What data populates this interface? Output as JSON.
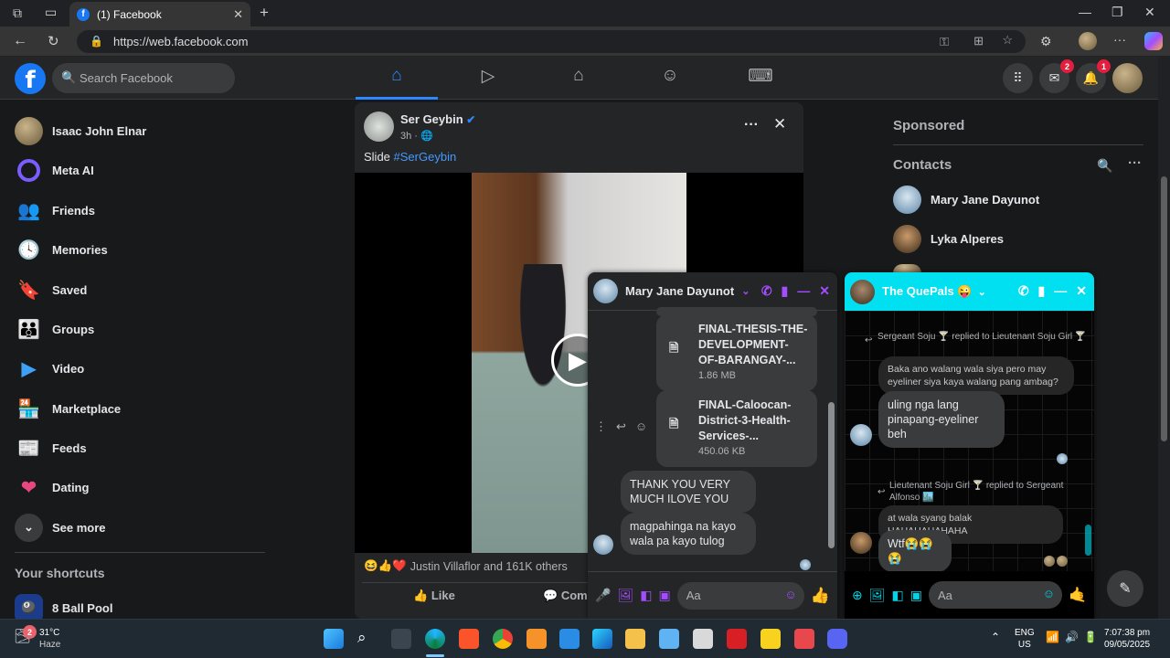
{
  "browser": {
    "tab_title": "(1) Facebook",
    "url": "https://web.facebook.com"
  },
  "header": {
    "search_placeholder": "Search Facebook",
    "messenger_badge": "2",
    "notifications_badge": "1"
  },
  "sidebar": {
    "items": [
      {
        "label": "Isaac John Elnar",
        "icon": "avatar"
      },
      {
        "label": "Meta AI",
        "icon": "meta-ai-icon"
      },
      {
        "label": "Friends",
        "icon": "friends-icon"
      },
      {
        "label": "Memories",
        "icon": "memories-icon"
      },
      {
        "label": "Saved",
        "icon": "saved-icon"
      },
      {
        "label": "Groups",
        "icon": "groups-icon"
      },
      {
        "label": "Video",
        "icon": "video-icon"
      },
      {
        "label": "Marketplace",
        "icon": "marketplace-icon"
      },
      {
        "label": "Feeds",
        "icon": "feeds-icon"
      },
      {
        "label": "Dating",
        "icon": "dating-icon"
      },
      {
        "label": "See more",
        "icon": "chevron-down-icon"
      }
    ],
    "shortcuts_title": "Your shortcuts",
    "shortcuts": [
      {
        "label": "8 Ball Pool"
      }
    ]
  },
  "post": {
    "author": "Ser Geybin",
    "time": "3h ·",
    "caption_text": "Slide ",
    "caption_hashtag": "#SerGeybin",
    "reactions_text": "Justin Villaflor and 161K others",
    "like_label": "Like",
    "comment_label": "Com"
  },
  "right": {
    "sponsored": "Sponsored",
    "contacts_title": "Contacts",
    "contacts": [
      {
        "name": "Mary Jane Dayunot"
      },
      {
        "name": "Lyka Alperes"
      }
    ]
  },
  "chat1": {
    "title": "Mary Jane Dayunot",
    "files": [
      {
        "name": "FINAL-THESIS-THE-DEVELOPMENT-OF-BARANGAY-...",
        "size": "1.86 MB"
      },
      {
        "name": "FINAL-Caloocan-District-3-Health-Services-...",
        "size": "450.06 KB"
      }
    ],
    "messages": [
      "THANK YOU VERY MUCH ILOVE YOU",
      "magpahinga na kayo wala pa kayo tulog"
    ],
    "input_placeholder": "Aa"
  },
  "chat2": {
    "title": "The QuePals 😜",
    "reply1": "Sergeant Soju 🍸 replied to Lieutenant Soju Girl 🍸",
    "quoted1": "Baka ano walang wala siya pero may eyeliner siya kaya walang pang ambag?",
    "message1": "uling nga lang pinapang-eyeliner beh",
    "reply2": "Lieutenant Soju Girl 🍸 replied to Sergeant Alfonso 🏙️",
    "quoted2": "at wala syang balak HAHAHAHAHAHA",
    "message2": "Wtf😭😭😭",
    "input_placeholder": "Aa"
  },
  "taskbar": {
    "weather_temp": "31°C",
    "weather_desc": "Haze",
    "weather_badge": "2",
    "lang_1": "ENG",
    "lang_2": "US",
    "time": "7:07:38 pm",
    "date": "09/05/2025"
  }
}
